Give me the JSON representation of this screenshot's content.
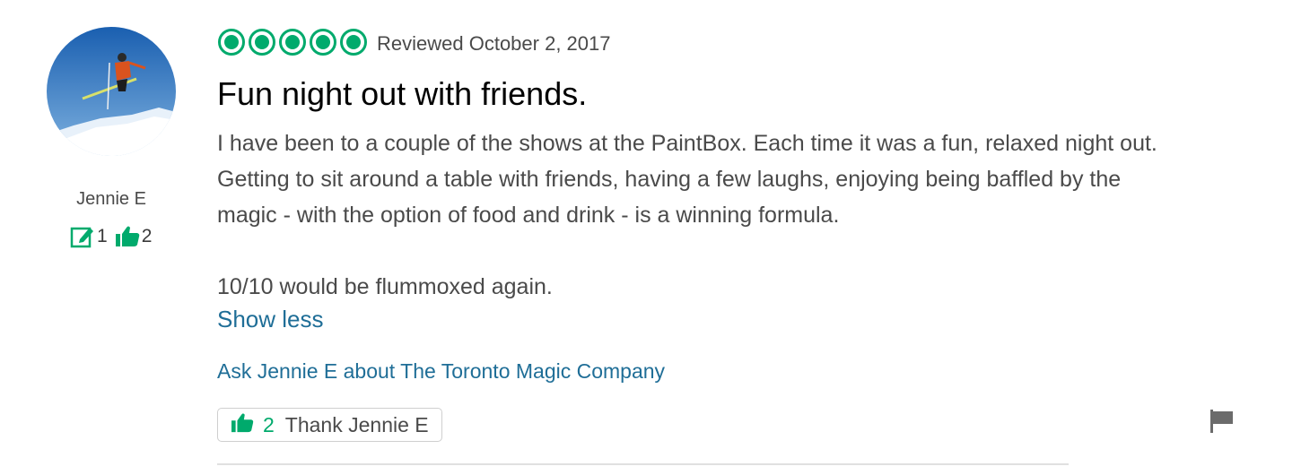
{
  "reviewer": {
    "name": "Jennie E",
    "contributions": "1",
    "helpful_votes": "2"
  },
  "review": {
    "rating_bubbles": 5,
    "date": "Reviewed October 2, 2017",
    "title": "Fun night out with friends.",
    "paragraphs": [
      "I have been to a couple of the shows at the PaintBox. Each time it was a fun, relaxed night out. Getting to sit around a table with friends, having a few laughs, enjoying being baffled by the magic - with the option of food and drink - is a winning formula.",
      "10/10 would be flummoxed again."
    ],
    "show_less": "Show less",
    "ask_link": "Ask Jennie E about The Toronto Magic Company",
    "thank_count": "2",
    "thank_label": "Thank Jennie E"
  },
  "colors": {
    "accent_green": "#00aa6c",
    "link_blue": "#1f6e97"
  },
  "icons": [
    "reviews-written-icon",
    "thumbs-up-icon",
    "flag-icon"
  ]
}
